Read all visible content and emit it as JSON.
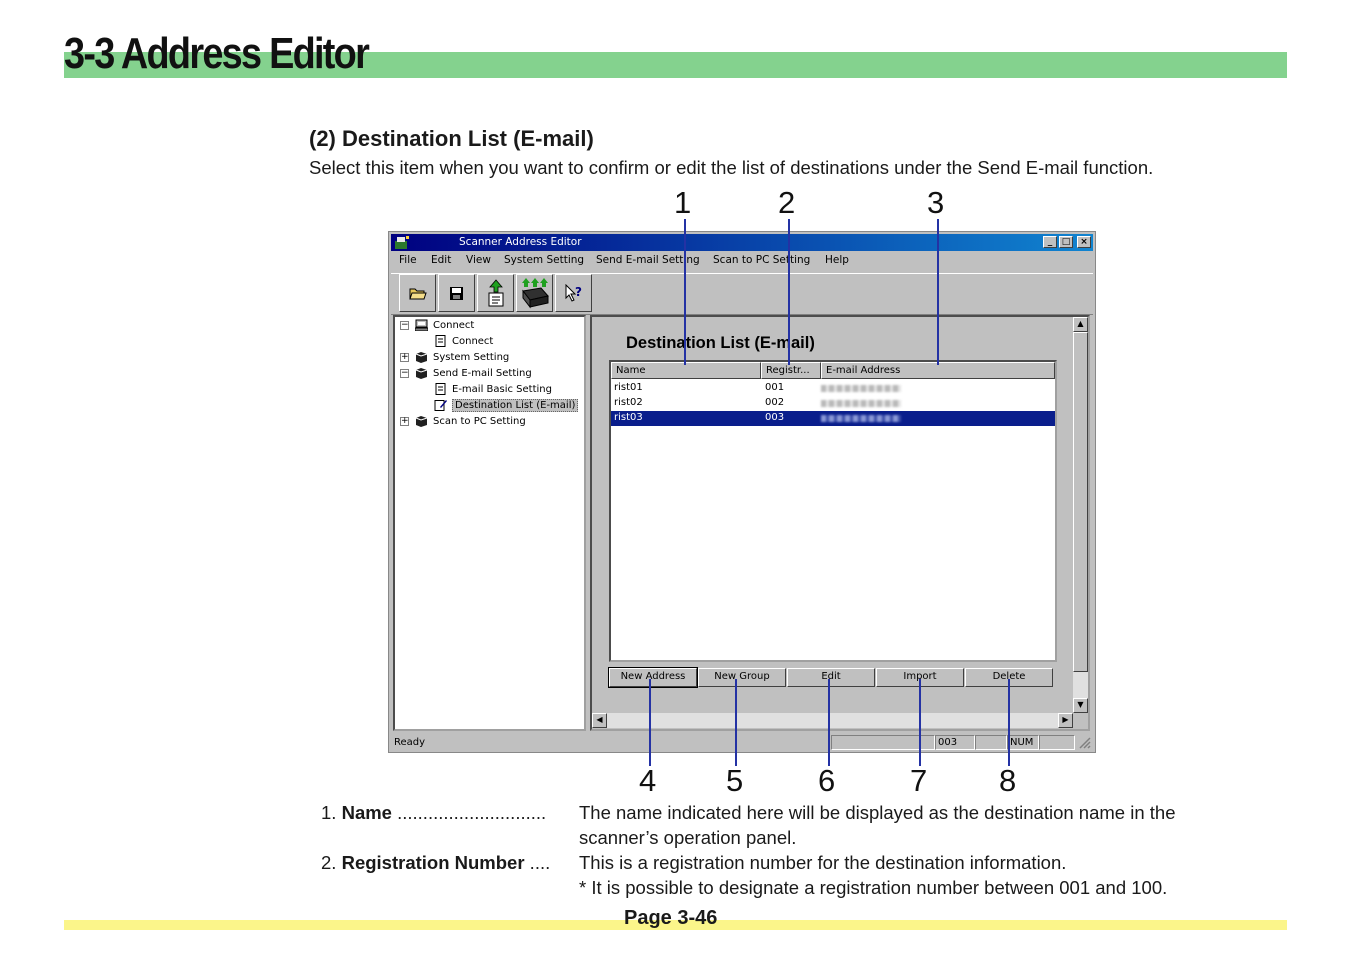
{
  "header": {
    "title": "3-3  Address Editor"
  },
  "section": {
    "heading": "(2) Destination List (E-mail)",
    "description": "Select this item when you want to confirm or edit the list of destinations under the Send E-mail function."
  },
  "callouts": [
    "1",
    "2",
    "3",
    "4",
    "5",
    "6",
    "7",
    "8"
  ],
  "window": {
    "title": "Scanner Address Editor",
    "menu": [
      "File",
      "Edit",
      "View",
      "System Setting",
      "Send E-mail Setting",
      "Scan to PC Setting",
      "Help"
    ],
    "toolbar_icons": [
      "open-folder-icon",
      "save-disk-icon",
      "upload-document-icon",
      "transfer-scanner-icon",
      "context-help-icon"
    ],
    "tree": [
      {
        "label": "Connect"
      },
      {
        "label": "Connect"
      },
      {
        "label": "System Setting"
      },
      {
        "label": "Send E-mail Setting"
      },
      {
        "label": "E-mail Basic Setting"
      },
      {
        "label": "Destination List (E-mail)"
      },
      {
        "label": "Scan to PC Setting"
      }
    ],
    "pane_title": "Destination List (E-mail)",
    "columns": [
      "Name",
      "Registr...",
      "E-mail Address"
    ],
    "rows": [
      {
        "name": "rist01",
        "reg": "001"
      },
      {
        "name": "rist02",
        "reg": "002"
      },
      {
        "name": "rist03",
        "reg": "003",
        "selected": true
      }
    ],
    "buttons": [
      "New Address",
      "New Group",
      "Edit",
      "Import",
      "Delete"
    ],
    "status": {
      "text": "Ready",
      "count": "003",
      "num": "NUM"
    }
  },
  "descriptions": [
    {
      "num": "1.",
      "term": "Name",
      "dots": " .............................",
      "text": "The name indicated here will be displayed as the destination name in the",
      "cont": "scanner’s operation panel."
    },
    {
      "num": "2.",
      "term": "Registration Number",
      "dots": " ....",
      "text": "This is a registration number for the destination information.",
      "note": "*  It is possible to designate a registration number between 001 and 100."
    }
  ],
  "footer": {
    "page": "Page 3-46"
  },
  "colors": {
    "header_band": "#84d28e",
    "footer_band": "#fbf58a",
    "callout_line": "#2432a4",
    "selection": "#0a1e8c"
  }
}
